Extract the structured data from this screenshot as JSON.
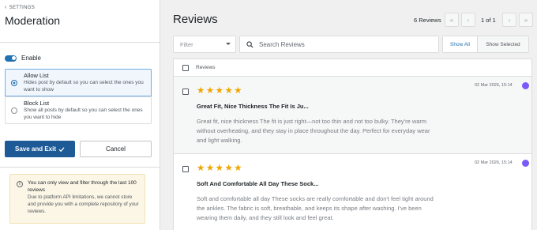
{
  "sidebar": {
    "back_label": "SETTINGS",
    "title": "Moderation",
    "enable_label": "Enable",
    "options": [
      {
        "title": "Allow List",
        "desc": "Hides post by default so you can select the ones you want to show",
        "selected": true
      },
      {
        "title": "Block List",
        "desc": "Show all posts by default so you can select the ones you want to hide",
        "selected": false
      }
    ],
    "save_label": "Save and Exit",
    "cancel_label": "Cancel",
    "notice": {
      "title": "You can only view and filter through the last 100 reviews",
      "body": "Due to platform API limitations, we cannot store and provide you with a complete repository of your reviews."
    }
  },
  "main": {
    "title": "Reviews",
    "count_label": "6 Reviews",
    "page_label": "1 of 1",
    "filter_placeholder": "Filter",
    "search_placeholder": "Search Reviews",
    "show_all_label": "Show All",
    "show_selected_label": "Show Selected",
    "list_header": "Reviews",
    "reviews": [
      {
        "rating": 5,
        "date": "02 Mar 2026, 15:14",
        "title": "Great Fit, Nice Thickness The Fit Is Ju...",
        "body": "Great fit, nice thickness The fit is just right—not too thin and not too bulky. They're warm without overheating, and they stay in place throughout the day. Perfect for everyday wear and light walking."
      },
      {
        "rating": 5,
        "date": "02 Mar 2026, 15:14",
        "title": "Soft And Comfortable All Day These Sock...",
        "body": "Soft and comfortable all day These socks are really comfortable and don't feel tight around the ankles. The fabric is soft, breathable, and keeps its shape after washing. I've been wearing them daily, and they still look and feel great."
      }
    ]
  },
  "colors": {
    "accent": "#2271b1",
    "save_button": "#1e5a96",
    "star": "#f0a500",
    "avatar": "#7a5af8",
    "notice_bg": "#fcf6e6"
  },
  "icons": [
    "chevron-left-icon",
    "check-icon",
    "info-icon",
    "search-icon",
    "first-page-icon",
    "prev-page-icon",
    "next-page-icon",
    "last-page-icon",
    "star-icon",
    "caret-down-icon"
  ]
}
